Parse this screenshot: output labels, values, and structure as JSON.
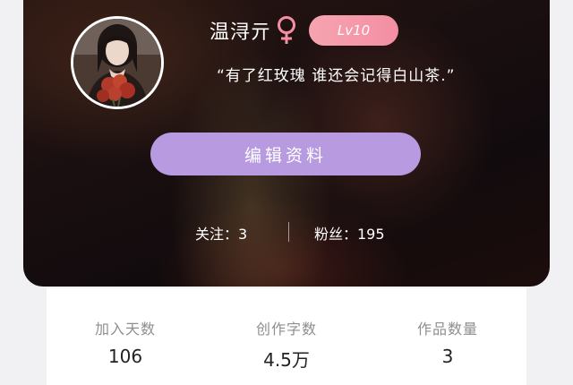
{
  "profile": {
    "username": "温浔亓",
    "gender_icon": "female-icon",
    "level_badge": "Lv10",
    "bio": "“有了红玫瑰 谁还会记得白山茶.”",
    "edit_button_label": "编辑资料",
    "following_label": "关注：3",
    "followers_label": "粉丝：195",
    "colors": {
      "accent_button": "#b79ae0",
      "level_badge": "#f48ea3",
      "gender_icon": "#f48ea3"
    }
  },
  "stats": [
    {
      "label": "加入天数",
      "value": "106"
    },
    {
      "label": "创作字数",
      "value": "4.5万"
    },
    {
      "label": "作品数量",
      "value": "3"
    }
  ]
}
